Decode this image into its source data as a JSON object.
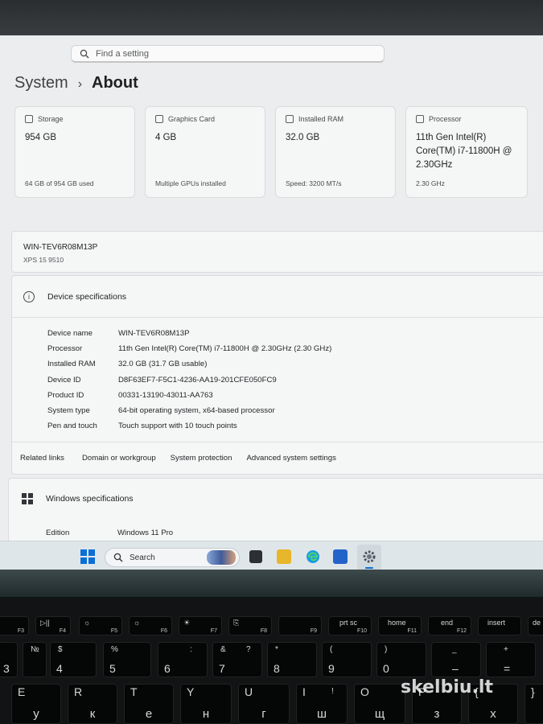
{
  "search": {
    "placeholder": "Find a setting"
  },
  "breadcrumb": {
    "parent": "System",
    "separator": "›",
    "current": "About"
  },
  "cards": [
    {
      "icon": "storage-icon",
      "label": "Storage",
      "value": "954 GB",
      "sub": "64 GB of 954 GB used"
    },
    {
      "icon": "graphics-card-icon",
      "label": "Graphics Card",
      "value": "4 GB",
      "sub": "Multiple GPUs installed"
    },
    {
      "icon": "ram-icon",
      "label": "Installed RAM",
      "value": "32.0 GB",
      "sub": "Speed: 3200 MT/s"
    },
    {
      "icon": "processor-icon",
      "label": "Processor",
      "value": "11th Gen Intel(R) Core(TM) i7-11800H @ 2.30GHz",
      "sub": "2.30 GHz"
    }
  ],
  "device": {
    "name": "WIN-TEV6R08M13P",
    "model": "XPS 15 9510"
  },
  "device_specs": {
    "title": "Device specifications",
    "info_icon": "i",
    "rows": [
      {
        "k": "Device name",
        "v": "WIN-TEV6R08M13P"
      },
      {
        "k": "Processor",
        "v": "11th Gen Intel(R) Core(TM) i7-11800H @ 2.30GHz (2.30 GHz)"
      },
      {
        "k": "Installed RAM",
        "v": "32.0 GB (31.7 GB usable)"
      },
      {
        "k": "Device ID",
        "v": "D8F63EF7-F5C1-4236-AA19-201CFE050FC9"
      },
      {
        "k": "Product ID",
        "v": "00331-13190-43011-AA763"
      },
      {
        "k": "System type",
        "v": "64-bit operating system, x64-based processor"
      },
      {
        "k": "Pen and touch",
        "v": "Touch support with 10 touch points"
      }
    ]
  },
  "related": {
    "label": "Related links",
    "links": [
      "Domain or workgroup",
      "System protection",
      "Advanced system settings"
    ]
  },
  "windows_specs": {
    "title": "Windows specifications",
    "edition_label": "Edition",
    "edition_value": "Windows 11 Pro"
  },
  "taskbar": {
    "search_label": "Search"
  },
  "keyboard": {
    "fn_row": [
      {
        "top": "",
        "bot": "F3"
      },
      {
        "top": "▷||",
        "bot": "F4"
      },
      {
        "top": "☼",
        "bot": "F5"
      },
      {
        "top": "☼",
        "bot": "F6"
      },
      {
        "top": "☀",
        "bot": "F7"
      },
      {
        "top": "⎘",
        "bot": "F8"
      },
      {
        "top": "",
        "bot": "F9"
      },
      {
        "top": "prt sc",
        "bot": "F10"
      },
      {
        "top": "home",
        "bot": "F11"
      },
      {
        "top": "end",
        "bot": "F12"
      },
      {
        "top": "insert",
        "bot": ""
      },
      {
        "top": "de",
        "bot": ""
      }
    ],
    "num_row": [
      {
        "sym": "",
        "big": "3"
      },
      {
        "sym": "№",
        "big": ""
      },
      {
        "sym": "$",
        "big": "4"
      },
      {
        "sym": "%",
        "big": "5"
      },
      {
        "sym": ":",
        "big": "6"
      },
      {
        "sym": "&",
        "big": "7"
      },
      {
        "sym": "*",
        "big": "8"
      },
      {
        "sym": "(",
        "big": "9"
      },
      {
        "sym": ")",
        "big": "0"
      },
      {
        "sym": "_",
        "big": "–"
      },
      {
        "sym": "+",
        "big": "="
      }
    ],
    "letter_row": [
      {
        "lat": "E",
        "cyr": "у"
      },
      {
        "lat": "R",
        "cyr": "к"
      },
      {
        "lat": "T",
        "cyr": "е"
      },
      {
        "lat": "Y",
        "cyr": "н"
      },
      {
        "lat": "U",
        "cyr": "г"
      },
      {
        "lat": "I",
        "cyr": "ш"
      },
      {
        "lat": "O",
        "cyr": "щ"
      },
      {
        "lat": "P",
        "cyr": "з"
      },
      {
        "lat": "{",
        "cyr": "х"
      },
      {
        "lat": "}",
        "cyr": ""
      }
    ],
    "extra": {
      "q": "?",
      "i": "!"
    }
  },
  "watermark": "skelbiu.lt"
}
